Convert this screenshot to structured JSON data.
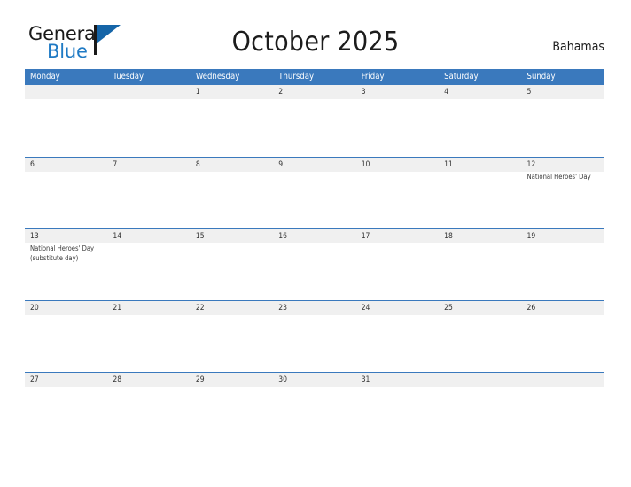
{
  "brand": {
    "name_top": "General",
    "name_bottom": "Blue",
    "logo_icon": "blue-flag-triangle-icon",
    "accent_color": "#1f7ac4",
    "flag_color": "#1565a8"
  },
  "header": {
    "title": "October 2025",
    "country": "Bahamas"
  },
  "theme": {
    "header_blue": "#3a79bd",
    "day_band_gray": "#f0f0f0",
    "text_color": "#333333",
    "event_text_color": "#3a3a3a"
  },
  "weekdays": [
    "Monday",
    "Tuesday",
    "Wednesday",
    "Thursday",
    "Friday",
    "Saturday",
    "Sunday"
  ],
  "weeks": [
    {
      "days": [
        {
          "date": "",
          "events": []
        },
        {
          "date": "",
          "events": []
        },
        {
          "date": "1",
          "events": []
        },
        {
          "date": "2",
          "events": []
        },
        {
          "date": "3",
          "events": []
        },
        {
          "date": "4",
          "events": []
        },
        {
          "date": "5",
          "events": []
        }
      ]
    },
    {
      "days": [
        {
          "date": "6",
          "events": []
        },
        {
          "date": "7",
          "events": []
        },
        {
          "date": "8",
          "events": []
        },
        {
          "date": "9",
          "events": []
        },
        {
          "date": "10",
          "events": []
        },
        {
          "date": "11",
          "events": []
        },
        {
          "date": "12",
          "events": [
            "National Heroes' Day"
          ]
        }
      ]
    },
    {
      "days": [
        {
          "date": "13",
          "events": [
            "National Heroes' Day (substitute day)"
          ]
        },
        {
          "date": "14",
          "events": []
        },
        {
          "date": "15",
          "events": []
        },
        {
          "date": "16",
          "events": []
        },
        {
          "date": "17",
          "events": []
        },
        {
          "date": "18",
          "events": []
        },
        {
          "date": "19",
          "events": []
        }
      ]
    },
    {
      "days": [
        {
          "date": "20",
          "events": []
        },
        {
          "date": "21",
          "events": []
        },
        {
          "date": "22",
          "events": []
        },
        {
          "date": "23",
          "events": []
        },
        {
          "date": "24",
          "events": []
        },
        {
          "date": "25",
          "events": []
        },
        {
          "date": "26",
          "events": []
        }
      ]
    },
    {
      "days": [
        {
          "date": "27",
          "events": []
        },
        {
          "date": "28",
          "events": []
        },
        {
          "date": "29",
          "events": []
        },
        {
          "date": "30",
          "events": []
        },
        {
          "date": "31",
          "events": []
        },
        {
          "date": "",
          "events": []
        },
        {
          "date": "",
          "events": []
        }
      ]
    }
  ]
}
